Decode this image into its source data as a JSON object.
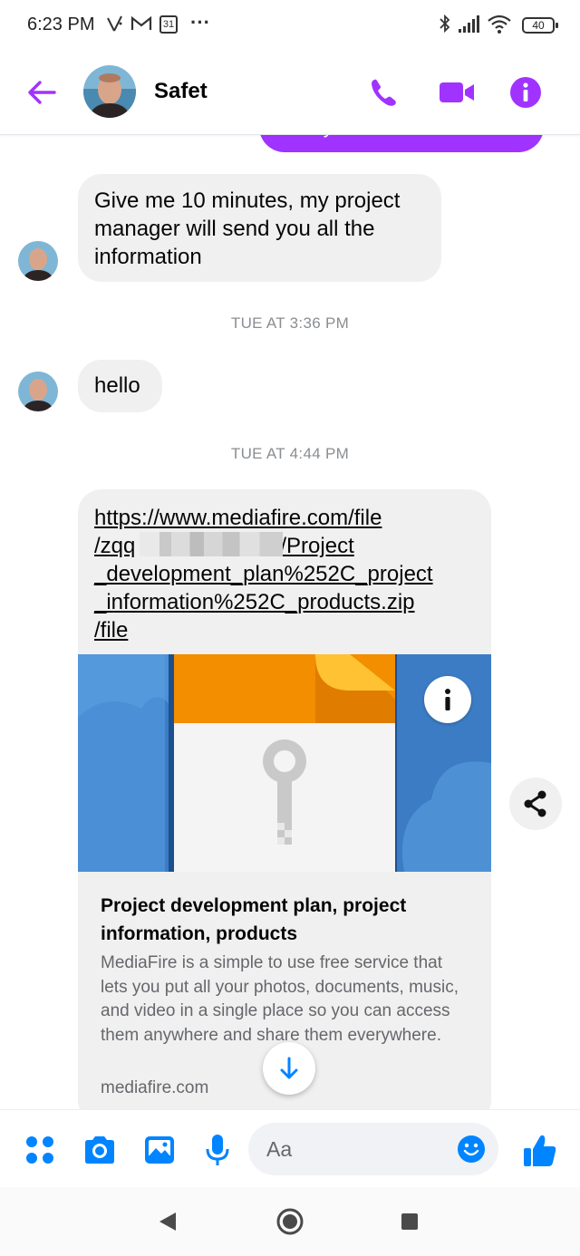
{
  "status_bar": {
    "time": "6:23 PM",
    "calendar_day": "31",
    "more": "···",
    "battery": "40",
    "icons": [
      "signal-slash-icon",
      "gmail-icon",
      "calendar-icon",
      "more-dots-icon",
      "bluetooth-icon",
      "cell-signal-icon",
      "wifi-icon",
      "battery-icon"
    ]
  },
  "header": {
    "contact_name": "Safet",
    "icons": [
      "back-arrow-icon",
      "phone-icon",
      "video-camera-icon",
      "info-icon"
    ],
    "accent_color": "#a033ff"
  },
  "conversation": {
    "outgoing_partial": "Do you have a website ?",
    "messages": [
      {
        "type": "incoming",
        "text": "Give me 10 minutes, my project manager will send you all the information"
      },
      {
        "type": "timestamp",
        "text": "TUE AT 3:36 PM"
      },
      {
        "type": "incoming",
        "text": "hello"
      },
      {
        "type": "timestamp",
        "text": "TUE AT 4:44 PM"
      }
    ],
    "link_message": {
      "url_lines": [
        "https://www.mediafire.com/file",
        "/zqq",
        "/Project",
        "_development_plan%252C_project",
        "_information%252C_products.zip",
        "/file"
      ],
      "preview_title": "Project development plan, project information, products",
      "preview_description": "MediaFire is a simple to use free service that lets you put all your photos, documents, music, and video in a single place so you can access them anywhere and share them everywhere.",
      "preview_domain": "mediafire.com"
    }
  },
  "composer": {
    "placeholder": "Aa",
    "icons": [
      "menu-dots-icon",
      "camera-icon",
      "gallery-icon",
      "microphone-icon",
      "emoji-icon",
      "thumbs-up-icon"
    ],
    "icon_color": "#0084ff"
  },
  "nav_bar": {
    "icons": [
      "back-triangle-icon",
      "home-circle-icon",
      "recents-square-icon"
    ]
  }
}
